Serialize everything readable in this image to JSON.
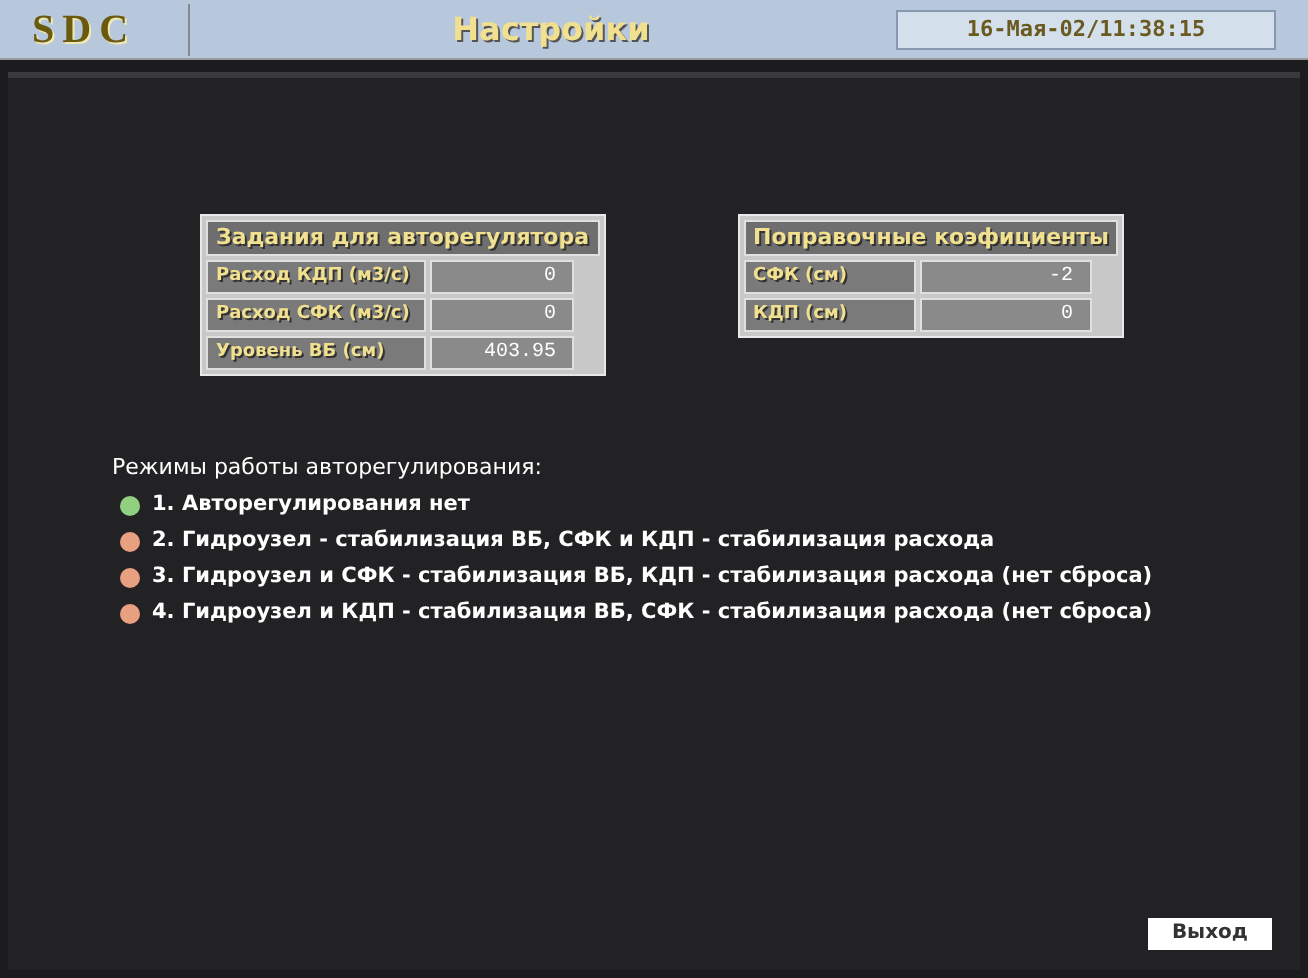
{
  "header": {
    "logo": "SDC",
    "title": "Настройки",
    "datetime": "16-Мая-02/11:38:15"
  },
  "setpoints": {
    "title": "Задания для авторегулятора",
    "rows": [
      {
        "label": "Расход КДП (м3/с)",
        "value": "0"
      },
      {
        "label": "Расход СФК (м3/с)",
        "value": "0"
      },
      {
        "label": "Уровень ВБ (см)",
        "value": "403.95"
      }
    ]
  },
  "corrections": {
    "title": "Поправочные коэфициенты",
    "rows": [
      {
        "label": "СФК (см)",
        "value": "-2"
      },
      {
        "label": "КДП (см)",
        "value": "0"
      }
    ]
  },
  "modes": {
    "title": "Режимы работы авторегулирования:",
    "items": [
      {
        "label": "1. Авторегулирования нет",
        "selected": true
      },
      {
        "label": "2. Гидроузел - стабилизация ВБ, СФК и КДП - стабилизация расхода",
        "selected": false
      },
      {
        "label": "3. Гидроузел и СФК - стабилизация ВБ, КДП - стабилизация расхода (нет сброса)",
        "selected": false
      },
      {
        "label": "4. Гидроузел и КДП - стабилизация ВБ, СФК - стабилизация расхода (нет сброса)",
        "selected": false
      }
    ]
  },
  "exit_button": "Выход"
}
